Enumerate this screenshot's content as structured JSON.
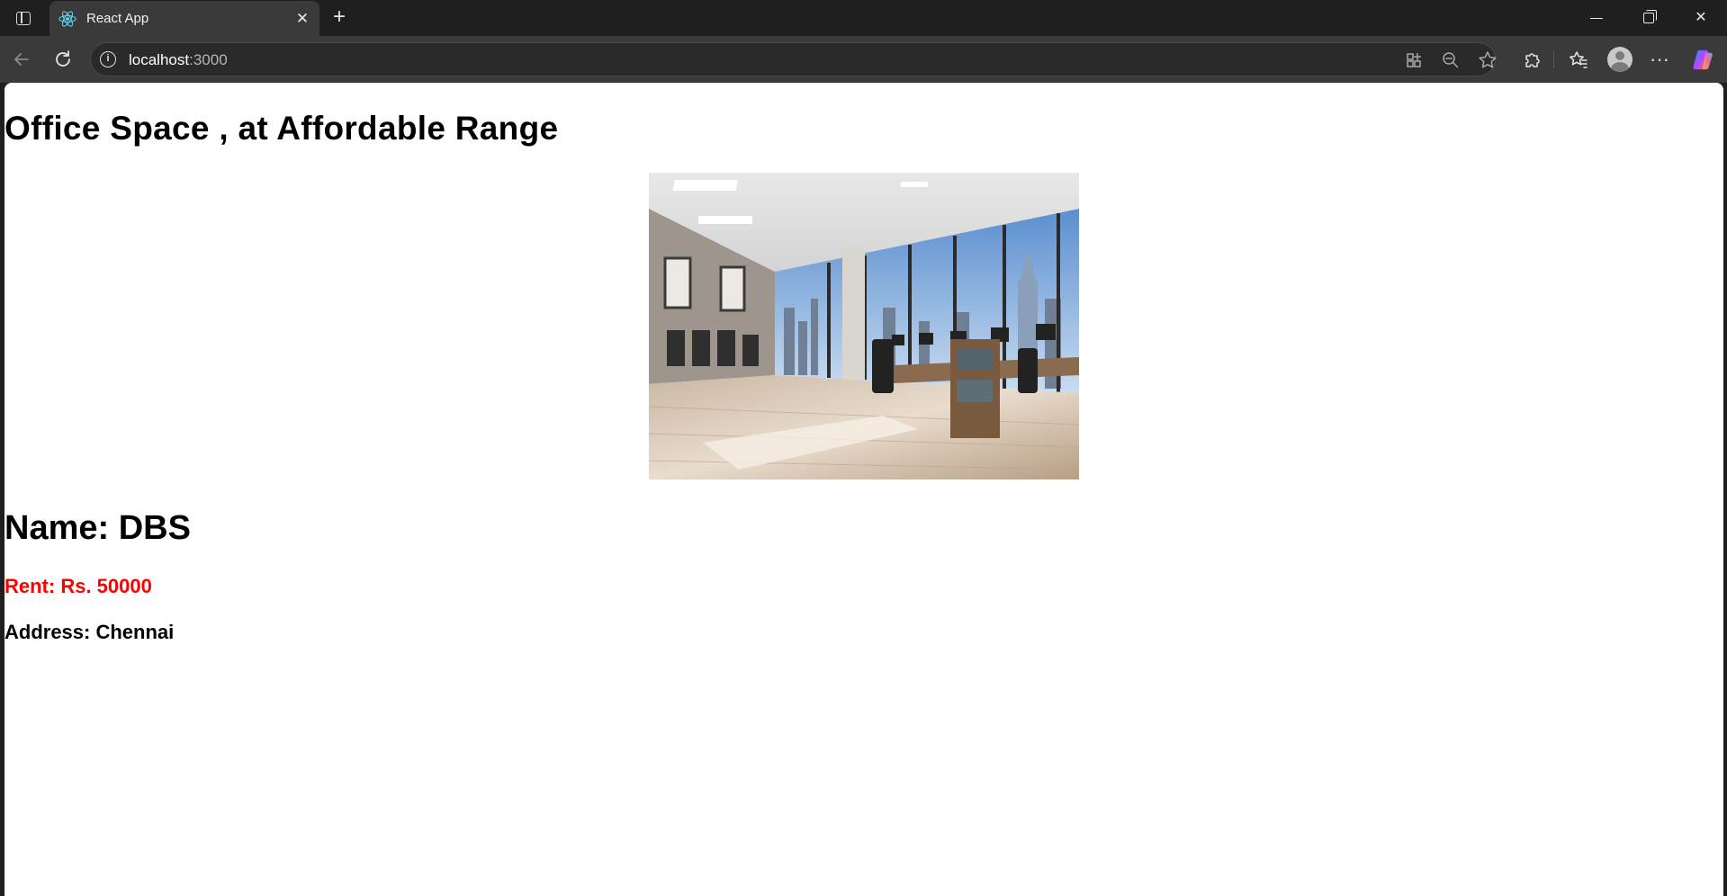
{
  "browser": {
    "tab": {
      "title": "React App",
      "favicon": "react-icon"
    },
    "address": {
      "host": "localhost",
      "port": ":3000"
    },
    "icons": {
      "sidebar": "sidebar-icon",
      "close_tab": "close-icon",
      "new_tab": "plus-icon",
      "back": "back-arrow-icon",
      "reload": "reload-icon",
      "site_info": "info-icon",
      "apps": "app-available-icon",
      "zoom": "zoom-out-icon",
      "favorite": "star-icon",
      "extensions": "puzzle-icon",
      "favorites": "favorites-icon",
      "profile": "avatar-icon",
      "more": "more-icon",
      "copilot": "copilot-icon"
    }
  },
  "page": {
    "title": "Office Space , at Affordable Range",
    "name": "Name: DBS",
    "rent": "Rent: Rs. 50000",
    "address": "Address: Chennai",
    "image_alt": "office-space-photo",
    "colors": {
      "rent": "#ff0000",
      "text": "#000000"
    }
  }
}
